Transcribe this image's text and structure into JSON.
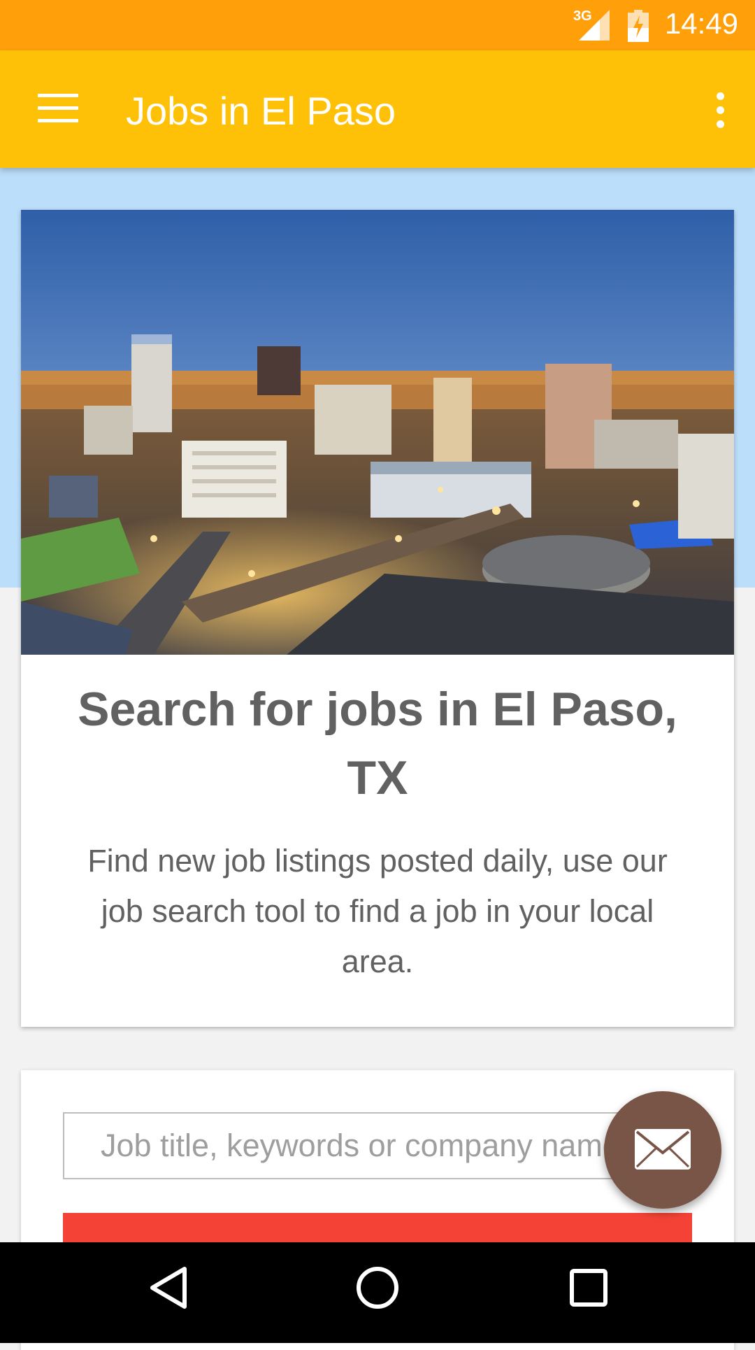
{
  "status_bar": {
    "network": "3G",
    "time": "14:49",
    "icons": [
      "signal-icon",
      "battery-charging-icon"
    ]
  },
  "app_bar": {
    "title": "Jobs in El Paso",
    "icons": [
      "menu-icon",
      "overflow-menu-icon"
    ]
  },
  "hero": {
    "image": "city-skyline-photo",
    "title": "Search for jobs in El Paso, TX",
    "description": "Find new job listings posted daily, use our job search tool to find a job in your local area."
  },
  "search": {
    "placeholder": "Job title, keywords or company name"
  },
  "fab": {
    "icon": "email-icon"
  },
  "nav_bar": {
    "icons": [
      "back-icon",
      "home-icon",
      "recent-apps-icon"
    ]
  },
  "colors": {
    "status_bar": "#ff9f0a",
    "app_bar": "#ffc107",
    "hero_band": "#bbdefb",
    "button": "#f44336",
    "fab": "#795548",
    "text": "#616161"
  }
}
